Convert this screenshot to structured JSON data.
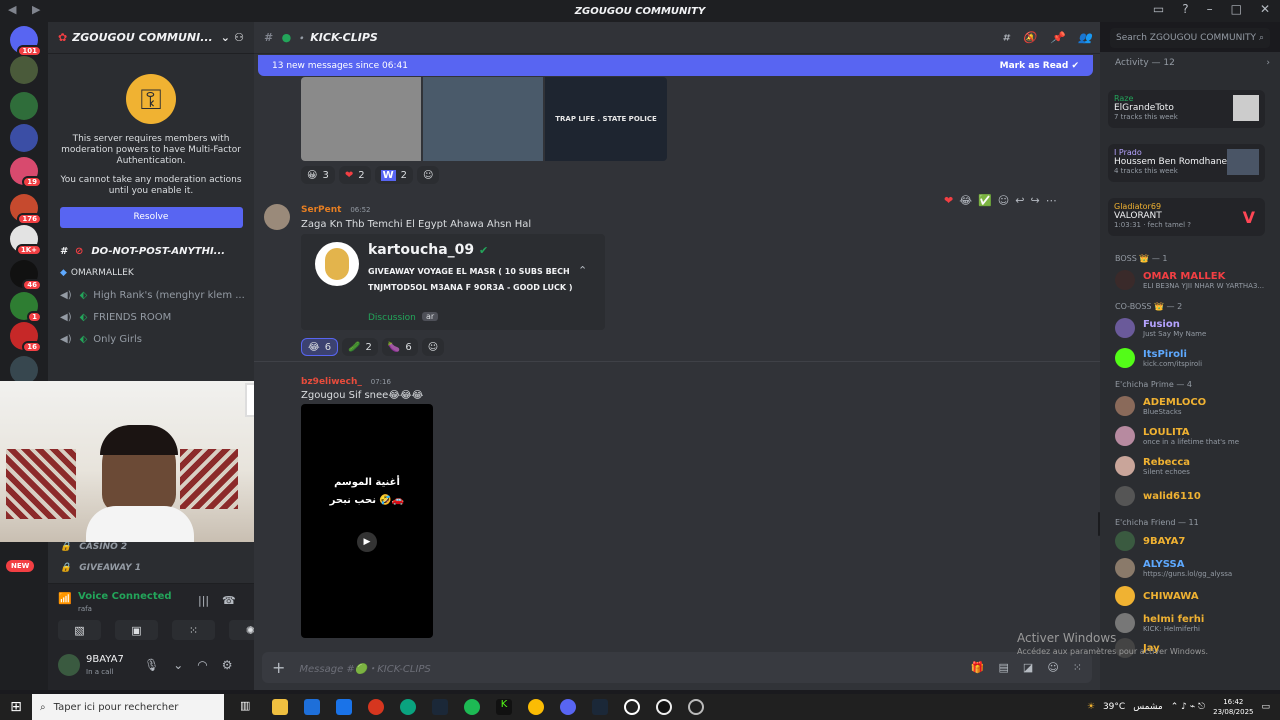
{
  "window": {
    "title": "ZGOUGOU COMMUNITY"
  },
  "guilds": {
    "badges": [
      "101",
      "19",
      "176",
      "1K+",
      "46",
      "1",
      "16"
    ],
    "new_label": "NEW"
  },
  "server": {
    "name": "ZGOUGOU COMMUNI...",
    "mfa_text1": "This server requires members with moderation powers to have Multi-Factor Authentication.",
    "mfa_text2": "You cannot take any moderation actions until you enable it.",
    "resolve_label": "Resolve",
    "channels": [
      {
        "name": "DO-NOT-POST-ANYTHI..."
      },
      {
        "name": "OMARMALLEK"
      },
      {
        "name": "High Rank's (menghyr klem ..."
      },
      {
        "name": "FRIENDS ROOM"
      },
      {
        "name": "Only Girls"
      },
      {
        "name": "CASINO 2"
      },
      {
        "name": "GIVEAWAY 1"
      }
    ]
  },
  "voice": {
    "status": "Voice Connected",
    "sub": "rafa"
  },
  "user": {
    "name": "9BAYA7",
    "status": "In a call"
  },
  "channel": {
    "name": "KICK-CLIPS"
  },
  "search": {
    "placeholder": "Search ZGOUGOU COMMUNITY"
  },
  "newbar": {
    "text": "13 new messages since 06:41",
    "action": "Mark as Read"
  },
  "message1": {
    "image_labels": [
      "TRAP LIFE . STATE POLICE"
    ],
    "reactions": [
      {
        "emoji": "😀",
        "count": "3"
      },
      {
        "emoji": "❤",
        "count": "2"
      },
      {
        "emoji": "W",
        "count": "2"
      }
    ]
  },
  "message2": {
    "author": "SerPent",
    "time": "06:52",
    "text": "Zaga Kn Thb Temchi El Egypt Ahawa Ahsn Hal",
    "embed_title": "kartoucha_09",
    "embed_text": "GIVEAWAY VOYAGE EL MASR ( 10 SUBS BECH TNJMTOD5OL M3ANA F 9OR3A - GOOD LUCK )",
    "embed_link": "Discussion",
    "embed_tag": "ar",
    "reactions": [
      {
        "emoji": "😂",
        "count": "6"
      },
      {
        "emoji": "🥒",
        "count": "2"
      },
      {
        "emoji": "🍆",
        "count": "6"
      }
    ]
  },
  "message3": {
    "author": "bz9eliwech_",
    "time": "07:16",
    "text": "Zgougou Sif snee😂😂😂",
    "video_line1": "أغنية الموسم",
    "video_line2": "نحب نبحر 🤣🚗"
  },
  "composer": {
    "placeholder": "Message #🟢・KICK-CLIPS"
  },
  "watermark": {
    "line1": "Activer Windows",
    "line2": "Accédez aux paramètres pour activer Windows."
  },
  "members": {
    "activity_header": "Activity — 12",
    "activities": [
      {
        "user": "Raze",
        "title": "ElGrandeToto",
        "sub": "7 tracks this week"
      },
      {
        "user": "I Prado",
        "title": "Houssem Ben Romdhane",
        "sub": "4 tracks this week"
      },
      {
        "user": "Gladiator69",
        "title": "VALORANT",
        "sub": "1:03:31 · fech tamel ?"
      }
    ],
    "groups": [
      {
        "name": "BOSS 👑 — 1",
        "members": [
          {
            "name": "OMAR MALLEK",
            "sub": "ELI BE3NA YJII NHAR W YARTHA3...",
            "color": "#f23f43"
          }
        ]
      },
      {
        "name": "CO-BOSS 👑 — 2",
        "members": [
          {
            "name": "Fusion",
            "sub": "Just Say My Name",
            "color": "#b5a3ff"
          },
          {
            "name": "ItsPiroli",
            "sub": "kick.com/itspiroli",
            "color": "#5ea9ff"
          }
        ]
      },
      {
        "name": "E'chicha Prime — 4",
        "members": [
          {
            "name": "ADEMLOCO",
            "sub": "BlueStacks",
            "color": "#f0b232"
          },
          {
            "name": "LOULITA",
            "sub": "once in a lifetime that's me",
            "color": "#f0b232"
          },
          {
            "name": "Rebecca",
            "sub": "Silent echoes",
            "color": "#f0b232"
          },
          {
            "name": "walid6110",
            "sub": "",
            "color": "#f0b232"
          }
        ]
      },
      {
        "name": "E'chicha Friend — 11",
        "members": [
          {
            "name": "9BAYA7",
            "sub": "",
            "color": "#f0b232"
          },
          {
            "name": "ALYSSA",
            "sub": "https://guns.lol/gg_alyssa",
            "color": "#f0b232"
          },
          {
            "name": "CHIWAWA",
            "sub": "",
            "color": "#f0b232"
          },
          {
            "name": "helmi ferhi",
            "sub": "KICK: Helmiferhi",
            "color": "#f0b232"
          },
          {
            "name": "Jay",
            "sub": "",
            "color": "#f0b232"
          }
        ]
      }
    ]
  },
  "taskbar": {
    "search_placeholder": "Taper ici pour rechercher",
    "weather": "39°C",
    "weather_label": "مشمس",
    "time": "16:42",
    "date": "23/08/2025"
  }
}
